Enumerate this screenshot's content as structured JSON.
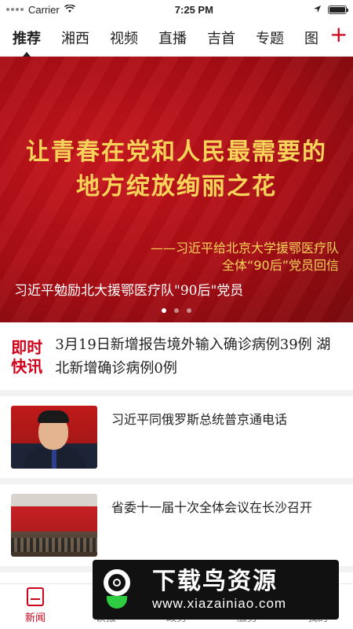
{
  "status_bar": {
    "carrier": "Carrier",
    "time": "7:25 PM"
  },
  "tabs": [
    {
      "label": "推荐",
      "active": true
    },
    {
      "label": "湘西"
    },
    {
      "label": "视频"
    },
    {
      "label": "直播"
    },
    {
      "label": "吉首"
    },
    {
      "label": "专题"
    },
    {
      "label": "图"
    }
  ],
  "add_tab_label": "+",
  "banner": {
    "headline_line1": "让青春在党和人民最需要的",
    "headline_line2": "地方绽放绚丽之花",
    "sub_line1": "——习近平给北京大学援鄂医疗队",
    "sub_line2": "全体“90后”党员回信",
    "caption": "习近平勉励北大援鄂医疗队\"90后\"党员",
    "slide_count": 3,
    "active_slide": 0
  },
  "flash": {
    "tag_line1": "即时",
    "tag_line2": "快讯",
    "text": "3月19日新增报告境外输入确诊病例39例  湖北新增确诊病例0例"
  },
  "news": [
    {
      "title": "习近平同俄罗斯总统普京通电话"
    },
    {
      "title": "省委十一届十次全体会议在长沙召开"
    }
  ],
  "tabbar": [
    {
      "label": "新闻",
      "icon": "news-icon",
      "active": true
    },
    {
      "label": "读报",
      "icon": "newspaper-icon"
    },
    {
      "label": "政务",
      "icon": "government-icon"
    },
    {
      "label": "服务",
      "icon": "service-icon"
    },
    {
      "label": "我的",
      "icon": "profile-icon"
    }
  ],
  "watermark": {
    "title": "下载鸟资源",
    "url": "www.xiazainiao.com"
  },
  "colors": {
    "accent": "#d0021b",
    "banner_text": "#f7d35a"
  }
}
